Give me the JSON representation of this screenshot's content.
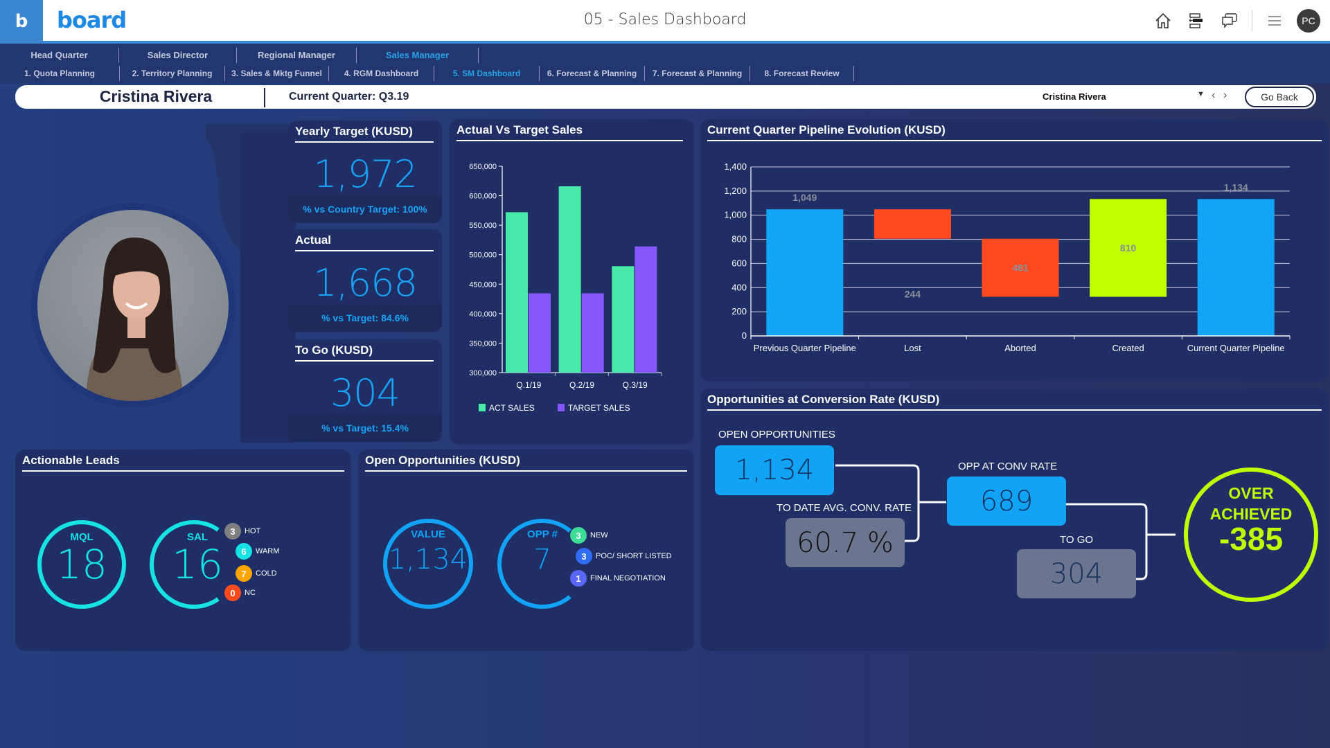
{
  "app": {
    "logo_letter": "b",
    "brand": "board",
    "title": "05 - Sales Dashboard",
    "user_initials": "PC",
    "icons": [
      "home-icon",
      "layout-arrange-icon",
      "chat-icon",
      "menu-icon"
    ]
  },
  "nav": {
    "row1": [
      {
        "label": "Head Quarter",
        "active": false
      },
      {
        "label": "Sales Director",
        "active": false
      },
      {
        "label": "Regional Manager",
        "active": false
      },
      {
        "label": "Sales Manager",
        "active": true
      }
    ],
    "row2": [
      {
        "label": "1. Quota Planning",
        "active": false
      },
      {
        "label": "2. Territory Planning",
        "active": false
      },
      {
        "label": "3. Sales & Mktg Funnel",
        "active": false
      },
      {
        "label": "4. RGM Dashboard",
        "active": false
      },
      {
        "label": "5. SM Dashboard",
        "active": true
      },
      {
        "label": "6. Forecast & Planning",
        "active": false
      },
      {
        "label": "7. Forecast & Planning",
        "active": false
      },
      {
        "label": "8. Forecast Review",
        "active": false
      }
    ]
  },
  "infobar": {
    "user_name": "Cristina Rivera",
    "current_quarter": "Current Quarter: Q3.19",
    "selector_value": "Cristina Rivera",
    "go_back": "Go Back"
  },
  "kpis": [
    {
      "title": "Yearly Target (KUSD)",
      "value": "1,972",
      "footer": "% vs Country Target: 100%"
    },
    {
      "title": "Actual",
      "value": "1,668",
      "footer": "% vs Target: 84.6%"
    },
    {
      "title": "To Go (KUSD)",
      "value": "304",
      "footer": "% vs Target: 15.4%"
    }
  ],
  "colors": {
    "act_sales": "#47eaa8",
    "target_sales": "#8857fb",
    "pipeline_total": "#12a5f7",
    "pipeline_decrease": "#ff4a1f",
    "pipeline_increase": "#bfff00",
    "cyan": "#17e3e6",
    "blue": "#12a3f7",
    "accent_green": "#bfff00"
  },
  "chart_data": [
    {
      "type": "bar",
      "title": "Actual Vs Target Sales",
      "categories": [
        "Q.1/19",
        "Q.2/19",
        "Q.3/19"
      ],
      "series": [
        {
          "name": "ACT SALES",
          "values": [
            572000,
            616000,
            480500
          ]
        },
        {
          "name": "TARGET SALES",
          "values": [
            434500,
            434500,
            514000
          ]
        }
      ],
      "ylim": [
        300000,
        650000
      ],
      "yticks": [
        "300,000",
        "350,000",
        "400,000",
        "450,000",
        "500,000",
        "550,000",
        "600,000",
        "650,000"
      ],
      "ytick_values": [
        300000,
        350000,
        400000,
        450000,
        500000,
        550000,
        600000,
        650000
      ],
      "legend": "bottom",
      "xlabel": "",
      "ylabel": ""
    },
    {
      "type": "bar",
      "subtype": "waterfall",
      "title": "Current Quarter Pipeline Evolution (KUSD)",
      "categories": [
        "Previous Quarter Pipeline",
        "Lost",
        "Aborted",
        "Created",
        "Current Quarter Pipeline"
      ],
      "values": [
        1049,
        -244,
        -481,
        810,
        1134
      ],
      "kinds": [
        "total",
        "decrease",
        "decrease",
        "increase",
        "total"
      ],
      "data_labels": [
        "1,049",
        "244",
        "481",
        "810",
        "1,134"
      ],
      "ylim": [
        0,
        1400
      ],
      "yticks": [
        "0",
        "200",
        "400",
        "600",
        "800",
        "1,000",
        "1,200",
        "1,400"
      ],
      "ytick_values": [
        0,
        200,
        400,
        600,
        800,
        1000,
        1200,
        1400
      ],
      "grid": true,
      "xlabel": "",
      "ylabel": ""
    }
  ],
  "leads": {
    "title": "Actionable Leads",
    "mql_label": "MQL",
    "mql_value": "18",
    "sal_label": "SAL",
    "sal_value": "16",
    "breakdown": [
      {
        "count": "3",
        "label": "HOT",
        "color": "#7f7f7f"
      },
      {
        "count": "6",
        "label": "WARM",
        "color": "#17e3e6"
      },
      {
        "count": "7",
        "label": "COLD",
        "color": "#ffa500"
      },
      {
        "count": "0",
        "label": "NC",
        "color": "#ff4a1f"
      }
    ]
  },
  "open_opps": {
    "title": "Open Opportunities (KUSD)",
    "value_label": "VALUE",
    "value": "1,134",
    "count_label": "OPP #",
    "count": "7",
    "breakdown": [
      {
        "count": "3",
        "label": "NEW",
        "color": "#3ddc97"
      },
      {
        "count": "3",
        "label": "POC/ SHORT LISTED",
        "color": "#2f6cf0"
      },
      {
        "count": "1",
        "label": "FINAL NEGOTIATION",
        "color": "#5868f5"
      }
    ]
  },
  "conversion": {
    "title": "Opportunities at Conversion Rate (KUSD)",
    "open_opp_label": "OPEN OPPORTUNITIES",
    "open_opp_value": "1,134",
    "conv_rate_label": "TO DATE AVG. CONV. RATE",
    "conv_rate_value": "60.7 %",
    "opp_conv_label": "OPP AT CONV RATE",
    "opp_conv_value": "689",
    "to_go_label": "TO GO",
    "to_go_value": "304",
    "result_line1": "OVER",
    "result_line2": "ACHIEVED",
    "result_value": "-385"
  }
}
